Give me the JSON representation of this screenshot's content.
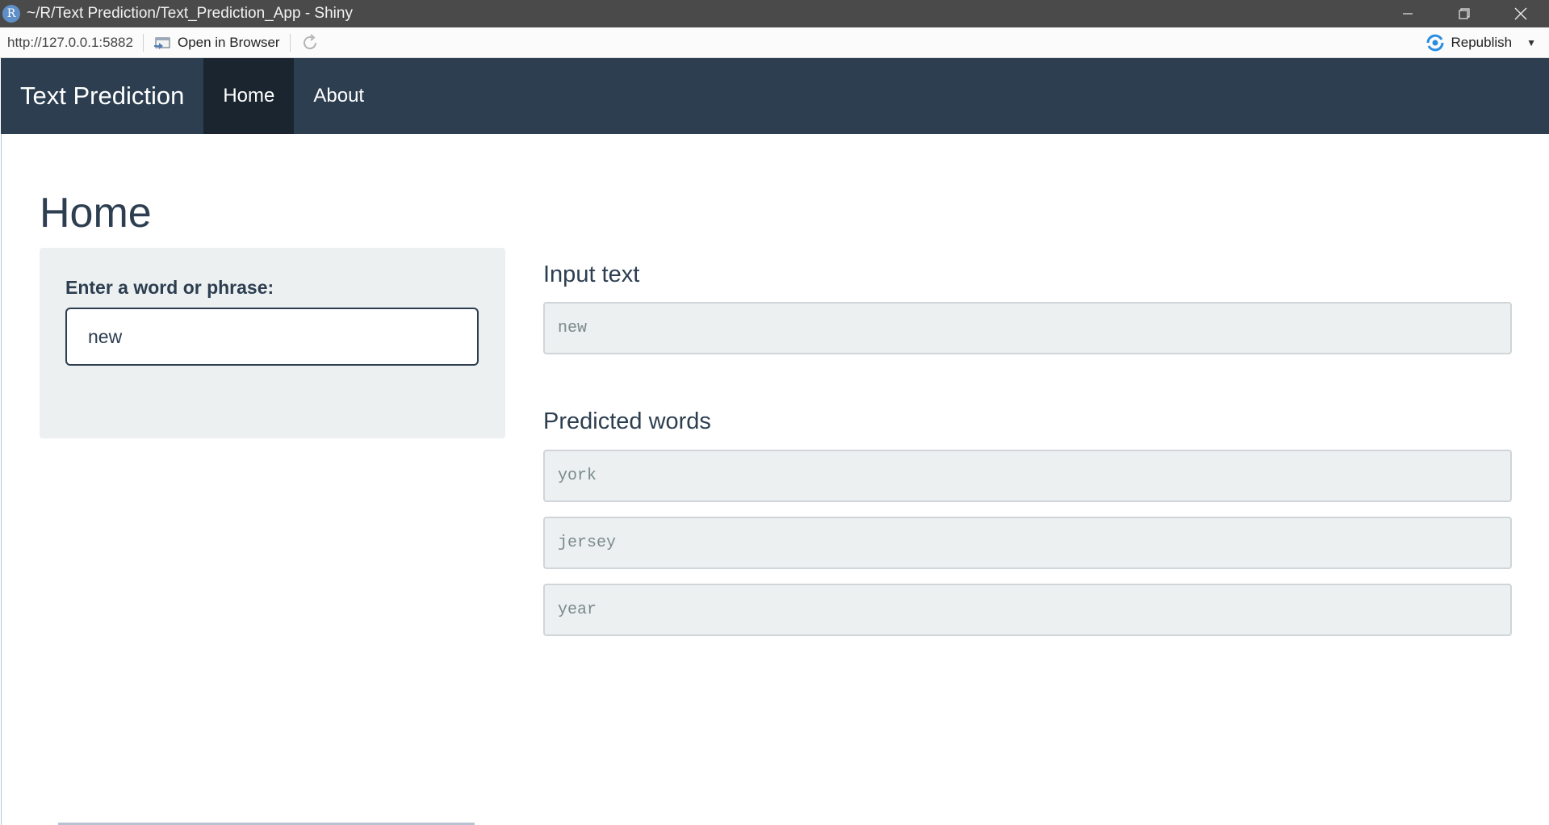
{
  "window": {
    "title": "~/R/Text Prediction/Text_Prediction_App - Shiny",
    "app_icon_letter": "R"
  },
  "toolbar": {
    "url": "http://127.0.0.1:5882",
    "open_in_browser": "Open in Browser",
    "republish": "Republish"
  },
  "navbar": {
    "brand": "Text Prediction",
    "items": [
      {
        "label": "Home",
        "active": true
      },
      {
        "label": "About",
        "active": false
      }
    ]
  },
  "page": {
    "title": "Home"
  },
  "sidebar": {
    "input_label": "Enter a word or phrase:",
    "input_value": "new"
  },
  "main": {
    "input_text_title": "Input text",
    "input_text_value": "new",
    "predicted_title": "Predicted words",
    "predictions": [
      "york",
      "jersey",
      "year"
    ]
  },
  "colors": {
    "navbar": "#2c3e50",
    "navbar_active": "#1a252f",
    "panel": "#ecf0f1",
    "text": "#2c3e50"
  }
}
